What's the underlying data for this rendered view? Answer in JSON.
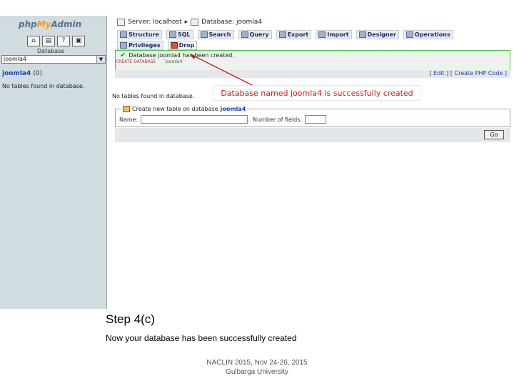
{
  "left": {
    "logo_php": "php",
    "logo_my": "My",
    "logo_admin": "Admin",
    "database_label": "Database",
    "database_select_value": "joomla4",
    "db_link": "joomla4",
    "db_count": "(0)",
    "no_tables": "No tables found in database."
  },
  "main": {
    "server_label": "Server: localhost",
    "database_label": "Database: joomla4",
    "tabs_row1": [
      "Structure",
      "SQL",
      "Search",
      "Query",
      "Export",
      "Import",
      "Designer",
      "Operations"
    ],
    "tabs_row2": [
      "Privileges",
      "Drop"
    ],
    "success_message": "Database joomla4 has been created.",
    "sql_text": "CREATE DATABASE",
    "sql_name": "`joomla4`",
    "edit_links": "[ Edit ] [ Create PHP Code ]",
    "callout": "Database named joomla4 is successfully created",
    "no_tables": "No tables found in database.",
    "create_legend": "Create new table on database",
    "create_db": "joomla4",
    "name_label": "Name:",
    "fields_label": "Number of fields:",
    "go_label": "Go"
  },
  "caption": {
    "title": "Step 4(c)",
    "description": "Now your database has been successfully created"
  },
  "footer": {
    "line1": "NACLIN 2015, Nov 24-26, 2015",
    "line2": "Gulbarga University"
  },
  "colors": {
    "callout_text": "#c8201e",
    "success_border": "#46c646",
    "link": "#1a3fbf"
  }
}
